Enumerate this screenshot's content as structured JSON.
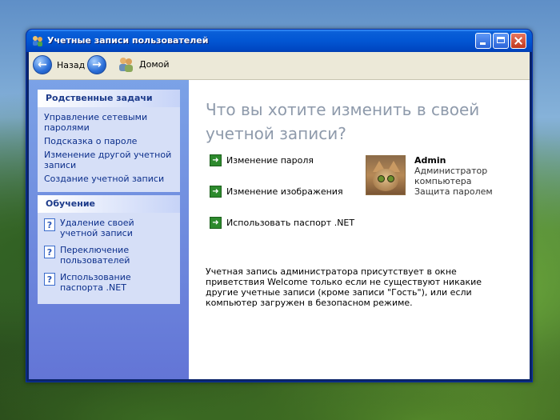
{
  "window": {
    "title": "Учетные записи пользователей"
  },
  "toolbar": {
    "back_label": "Назад",
    "home_label": "Домой"
  },
  "sidebar": {
    "related_tasks": {
      "title": "Родственные задачи",
      "items": [
        "Управление сетевыми паролями",
        "Подсказка о пароле",
        "Изменение другой учетной записи",
        "Создание учетной записи"
      ]
    },
    "learn": {
      "title": "Обучение",
      "items": [
        "Удаление своей учетной записи",
        "Переключение пользователей",
        "Использование паспорта .NET"
      ]
    }
  },
  "main": {
    "heading": "Что вы хотите изменить в своей учетной записи?",
    "actions": [
      "Изменение пароля",
      "Изменение изображения",
      "Использовать паспорт .NET"
    ],
    "account": {
      "name": "Admin",
      "role": "Администратор компьютера",
      "status": "Защита паролем"
    },
    "note": "Учетная запись администратора присутствует в окне приветствия Welcome только если не существуют никакие другие учетные записи (кроме записи \"Гость\"), или если компьютер загружен в безопасном режиме."
  },
  "colors": {
    "titlebar": "#0256d3",
    "sidebar": "#6f8ddf",
    "heading": "#8e9aab",
    "link": "#0c2f8b"
  }
}
